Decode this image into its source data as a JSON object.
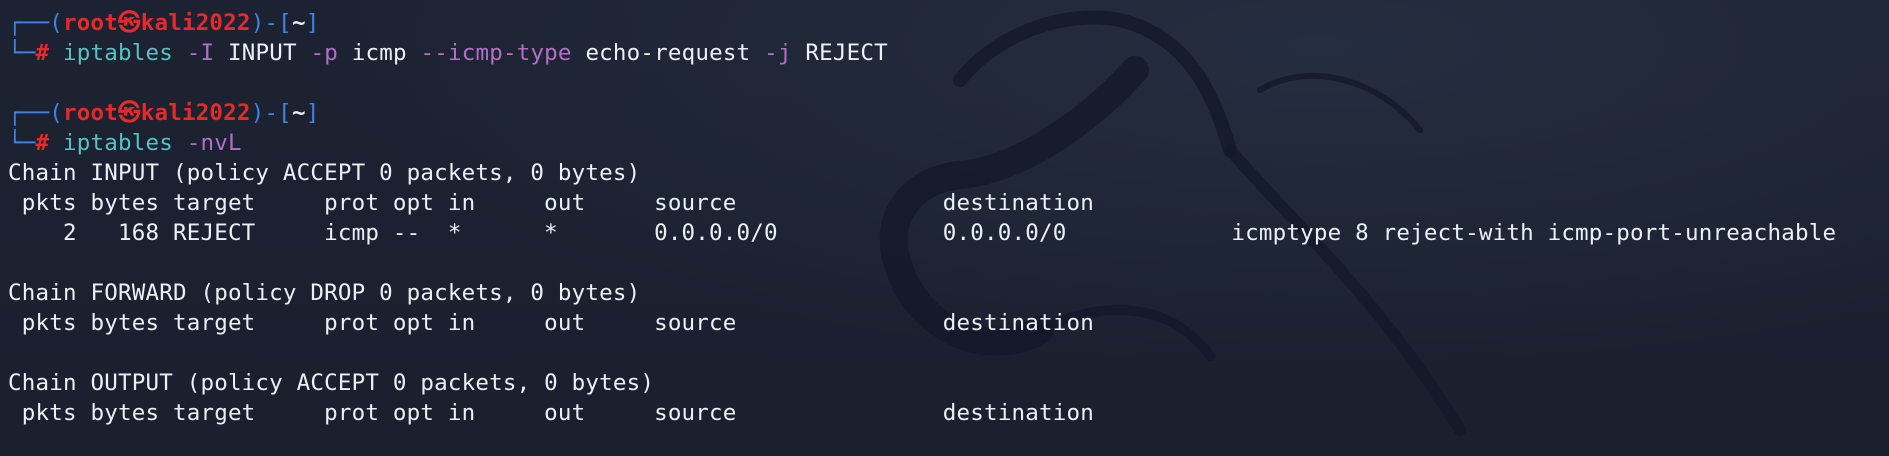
{
  "prompt": {
    "user": "root",
    "skull": "㉿",
    "host": "kali2022",
    "dir": "~",
    "symbol": "#"
  },
  "commands": [
    {
      "name": "iptables",
      "tokens": [
        {
          "kind": "opt",
          "text": "-I"
        },
        {
          "kind": "arg",
          "text": "INPUT"
        },
        {
          "kind": "opt",
          "text": "-p"
        },
        {
          "kind": "arg",
          "text": "icmp"
        },
        {
          "kind": "opt",
          "text": "--icmp-type"
        },
        {
          "kind": "arg",
          "text": "echo-request"
        },
        {
          "kind": "opt",
          "text": "-j"
        },
        {
          "kind": "arg",
          "text": "REJECT"
        }
      ]
    },
    {
      "name": "iptables",
      "tokens": [
        {
          "kind": "opt",
          "text": "-nvL"
        }
      ]
    }
  ],
  "output": {
    "input_chain": "Chain INPUT (policy ACCEPT 0 packets, 0 bytes)",
    "input_header": " pkts bytes target     prot opt in     out     source               destination         ",
    "input_row": "    2   168 REJECT     icmp --  *      *       0.0.0.0/0            0.0.0.0/0            icmptype 8 reject-with icmp-port-unreachable",
    "forward_chain": "Chain FORWARD (policy DROP 0 packets, 0 bytes)",
    "forward_header": " pkts bytes target     prot opt in     out     source               destination         ",
    "output_chain": "Chain OUTPUT (policy ACCEPT 0 packets, 0 bytes)",
    "output_header": " pkts bytes target     prot opt in     out     source               destination         "
  }
}
